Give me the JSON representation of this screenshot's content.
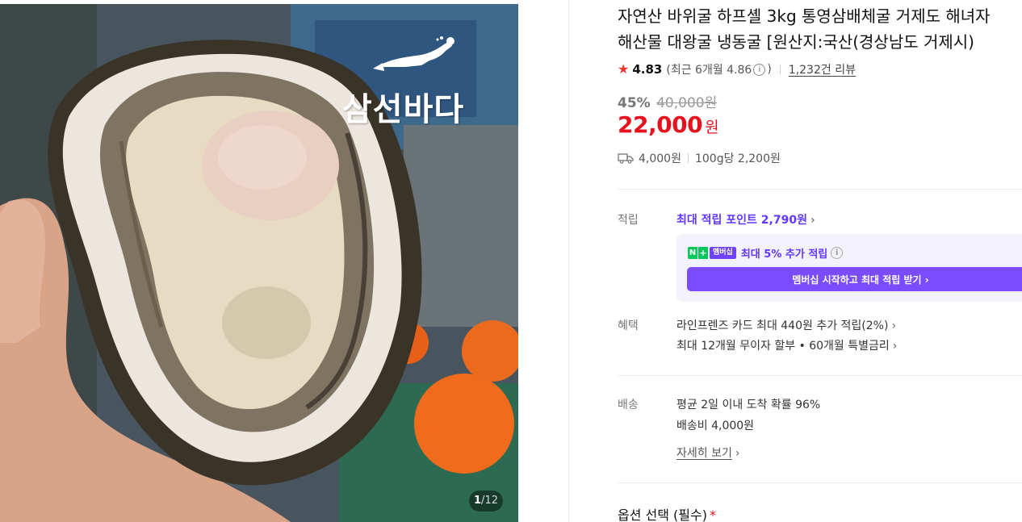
{
  "gallery": {
    "brand_watermark": "삼선바다",
    "current_index": "1",
    "total_count": "12"
  },
  "product": {
    "title_line1": "자연산 바위굴 하프셸 3kg 통영삼배체굴 거제도 해녀자",
    "title_line2": "해산물 대왕굴 냉동굴 [원산지:국산(경상남도 거제시)"
  },
  "rating": {
    "score": "4.83",
    "recent_label": "(최근 6개월 4.86",
    "recent_suffix": ")",
    "info_icon": "i",
    "review_count": "1,232건 리뷰"
  },
  "price": {
    "discount": "45%",
    "original": "40,000원",
    "sale": "22,000",
    "unit": "원"
  },
  "shipping_summary": {
    "fee": "4,000원",
    "unit_price": "100g당 2,200원"
  },
  "points": {
    "label": "적립",
    "link_prefix": "최대 적립 포인트",
    "link_value": "2,790원",
    "chevron": "›"
  },
  "membership": {
    "badge_n": "N",
    "badge_plus": "+",
    "badge_text": "멤버십",
    "text": "최대 5% 추가 적립",
    "button_label": "멤버십 시작하고 최대 적립 받기 ›"
  },
  "benefits": {
    "label": "혜택",
    "card": "라인프렌즈 카드 최대 440원 추가 적립(2%)",
    "installment": "최대 12개월 무이자 할부 • 60개월 특별금리"
  },
  "delivery": {
    "label": "배송",
    "arrival": "평균 2일 이내 도착 확률 96%",
    "fee": "배송비 4,000원",
    "detail_link": "자세히 보기"
  },
  "options": {
    "title": "옵션 선택 (필수)",
    "required_mark": "*"
  },
  "colors": {
    "sale_red": "#e6121d",
    "point_purple": "#6236ff",
    "npay_green": "#03c75a"
  }
}
